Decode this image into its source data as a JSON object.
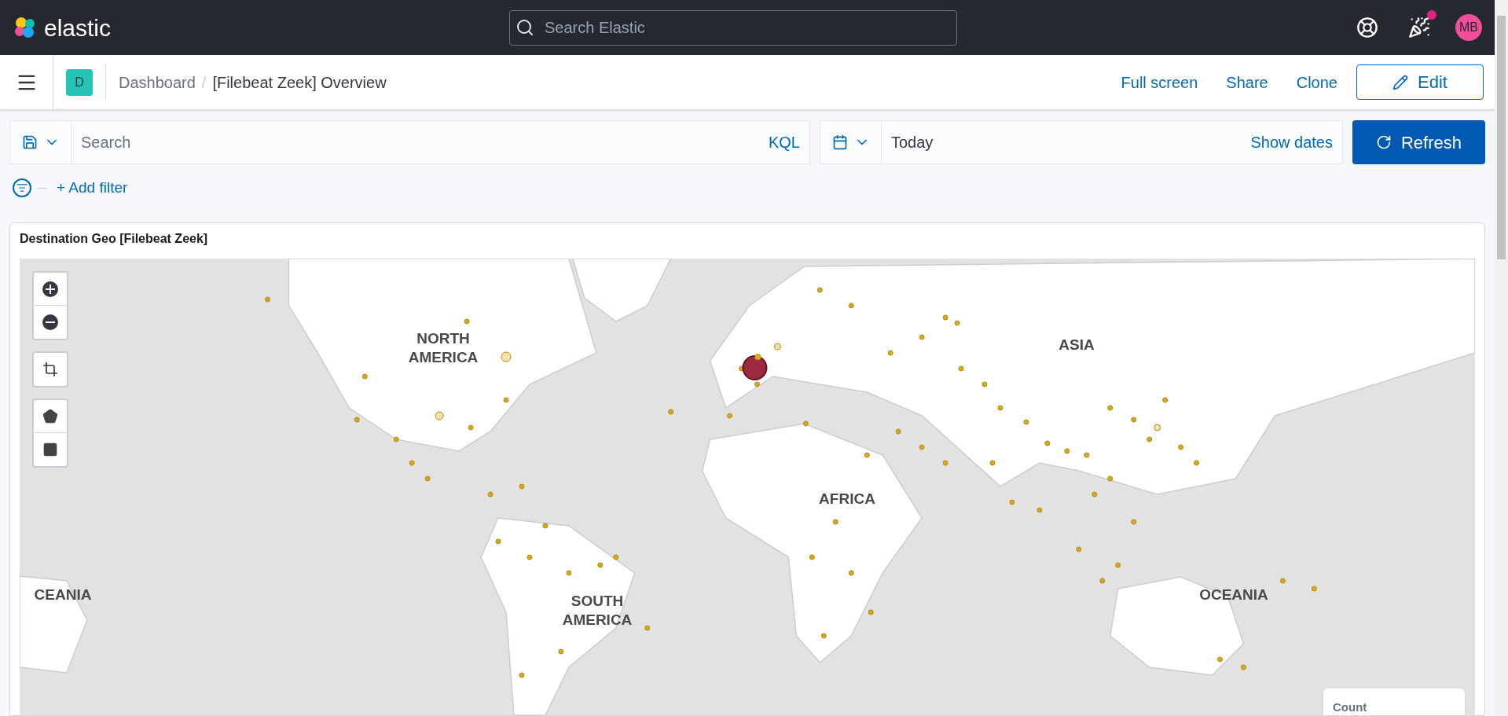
{
  "top_bar": {
    "brand": "elastic",
    "search": {
      "placeholder": "Search Elastic"
    },
    "news_badge": true,
    "avatar": "MB"
  },
  "header": {
    "app_badge": "D",
    "breadcrumbs": [
      "Dashboard",
      "[Filebeat Zeek] Overview"
    ],
    "separator": "/",
    "links": [
      "Full screen",
      "Share",
      "Clone"
    ],
    "edit_button": "Edit"
  },
  "query_bar": {
    "search": {
      "placeholder": "Search"
    },
    "language": "KQL",
    "date": "Today",
    "show_dates": "Show dates",
    "refresh": "Refresh"
  },
  "filter_bar": {
    "add_filter": "+ Add filter"
  },
  "panel": {
    "title": "Destination Geo [Filebeat Zeek]",
    "map_labels": [
      "NORTH AMERICA",
      "ASIA",
      "AFRICA",
      "CEANIA",
      "SOUTH AMERICA",
      "OCEANIA"
    ],
    "legend": {
      "title": "Count"
    }
  }
}
